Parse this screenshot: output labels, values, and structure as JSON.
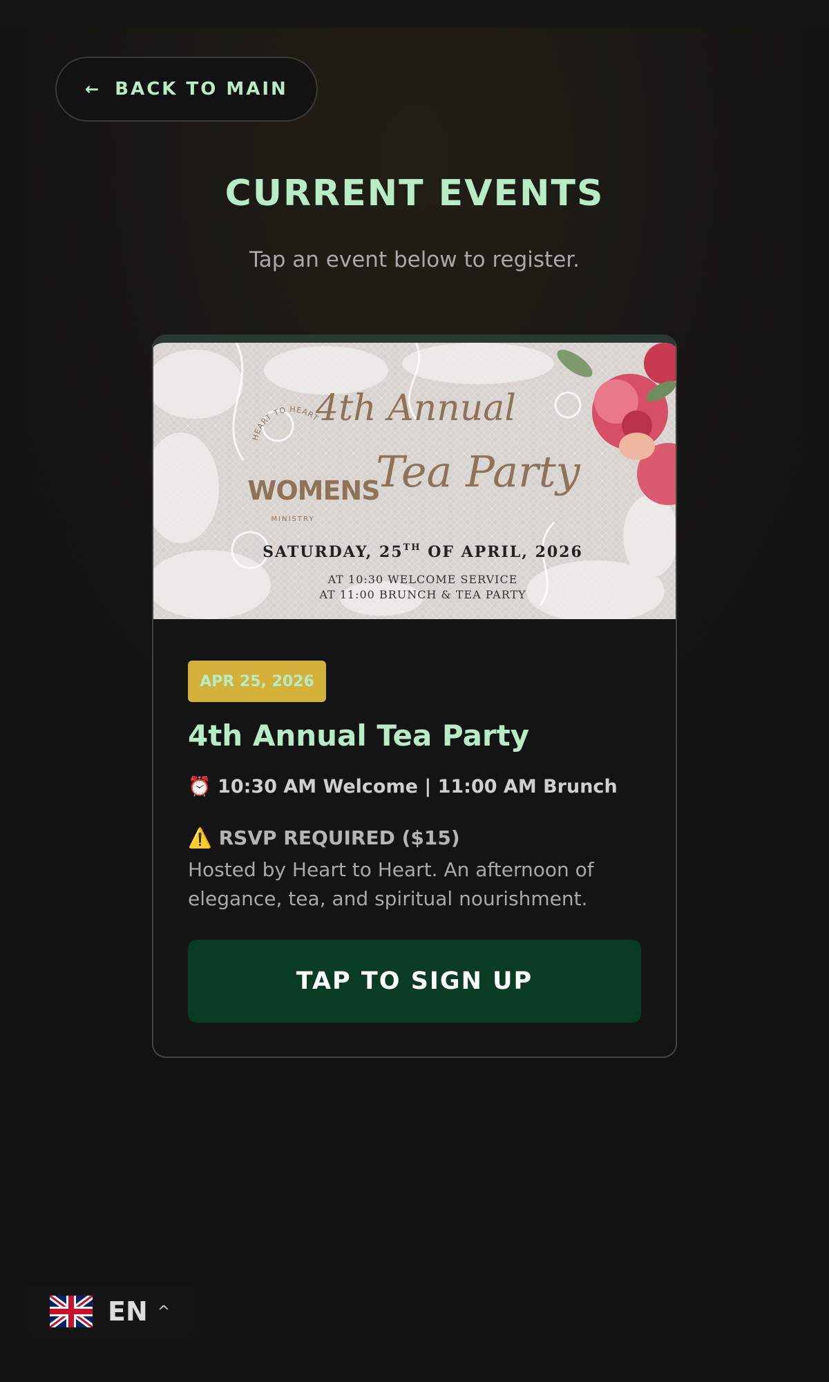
{
  "nav": {
    "back_arrow": "←",
    "back_label": "BACK TO MAIN"
  },
  "header": {
    "title": "CURRENT EVENTS",
    "subtitle": "Tap an event below to register."
  },
  "event": {
    "banner": {
      "headline_1": "4th Annual",
      "headline_2": "Tea Party",
      "logo_arc_top": "HEART TO HEART",
      "logo_word": "WOMENS",
      "logo_arc_bottom": "MINISTRY",
      "date_line_1": "SATURDAY, 25",
      "date_sup": "TH",
      "date_line_2": " OF APRIL, 2026",
      "schedule_1": "AT 10:30 WELCOME SERVICE",
      "schedule_2": "AT 11:00 BRUNCH & TEA PARTY"
    },
    "date_badge": "APR 25, 2026",
    "title": "4th Annual Tea Party",
    "time_icon": "⏰",
    "time": "10:30 AM Welcome | 11:00 AM Brunch",
    "rsvp_icon": "⚠️",
    "rsvp": "RSVP REQUIRED ($15)",
    "description": "Hosted by Heart to Heart. An afternoon of elegance, tea, and spiritual nourishment.",
    "signup_label": "TAP TO SIGN UP"
  },
  "language": {
    "flag_icon": "uk-flag-icon",
    "code": "EN",
    "caret": "^"
  },
  "colors": {
    "accent": "#b8ecc6",
    "badge": "#d4b13a",
    "button": "#0a3b24",
    "background": "#121212"
  }
}
